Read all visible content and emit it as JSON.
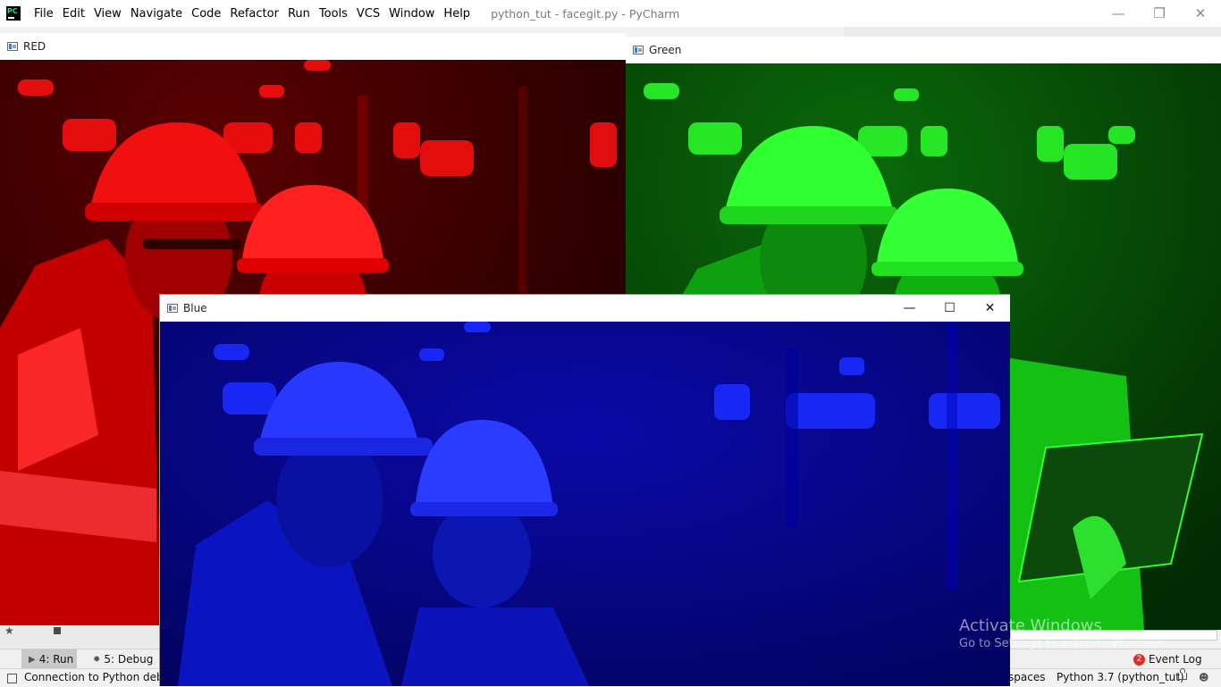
{
  "ide": {
    "menus": [
      "File",
      "Edit",
      "View",
      "Navigate",
      "Code",
      "Refactor",
      "Run",
      "Tools",
      "VCS",
      "Window",
      "Help"
    ],
    "window_title": "python_tut - facegit.py - PyCharm",
    "logo_text": "PC"
  },
  "windows": {
    "red": {
      "title": "RED",
      "accent": "#ff0000"
    },
    "green": {
      "title": "Green",
      "accent": "#00ff00"
    },
    "blue": {
      "title": "Blue",
      "accent": "#0000ff"
    }
  },
  "toolwindows": {
    "run_label": "4: Run",
    "debug_label": "5: Debug",
    "event_log_label": "Event Log",
    "event_log_count": "2"
  },
  "status": {
    "message": "Connection to Python debug",
    "indent": "spaces",
    "interpreter": "Python 3.7 (python_tut)"
  },
  "watermark": {
    "title": "Activate Windows",
    "subtitle": "Go to Settings to activate Windows."
  }
}
